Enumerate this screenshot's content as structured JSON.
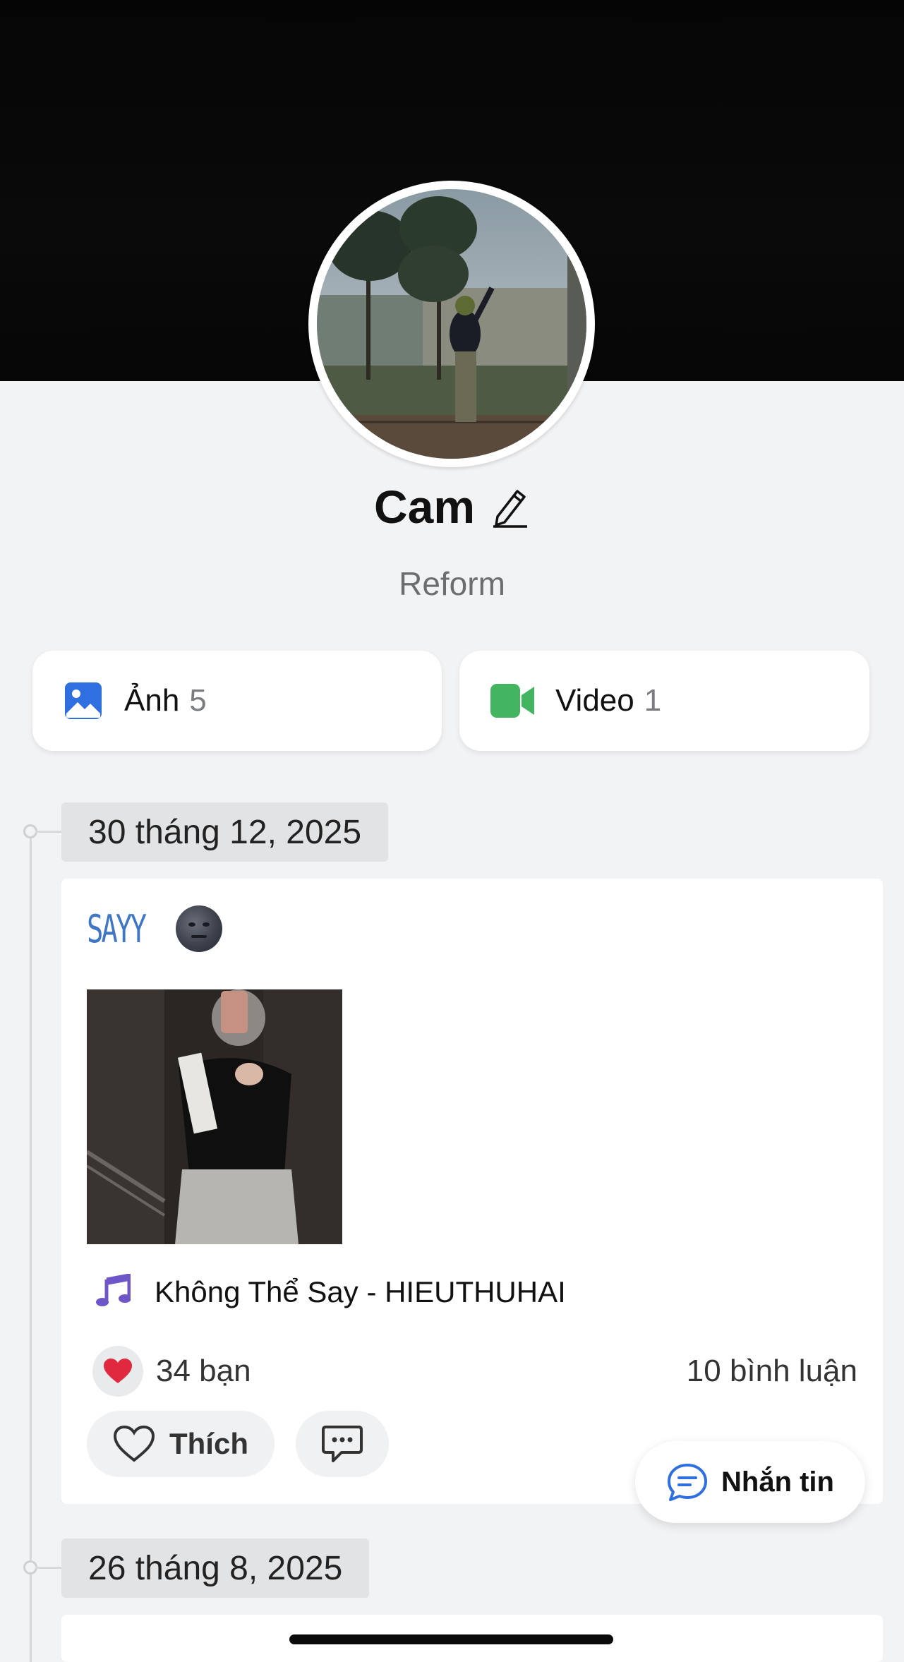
{
  "profile": {
    "name": "Cam",
    "status": "Reform"
  },
  "media": {
    "photos_label": "Ảnh",
    "photos_count": "5",
    "videos_label": "Video",
    "videos_count": "1"
  },
  "timeline": [
    {
      "date": "30 tháng 12, 2025",
      "caption": "SAYY",
      "caption_emoji": "new-moon-face",
      "music": "Không Thể Say - HIEUTHUHAI",
      "reactions": "34 bạn",
      "comments": "10 bình luận",
      "like_label": "Thích"
    },
    {
      "date": "26 tháng 8, 2025"
    }
  ],
  "chat_button": {
    "label": "Nhắn tin"
  },
  "colors": {
    "accent_blue": "#2f6fe0",
    "video_green": "#43b561",
    "music_purple": "#6e55c8",
    "heart_red": "#e0283e"
  }
}
